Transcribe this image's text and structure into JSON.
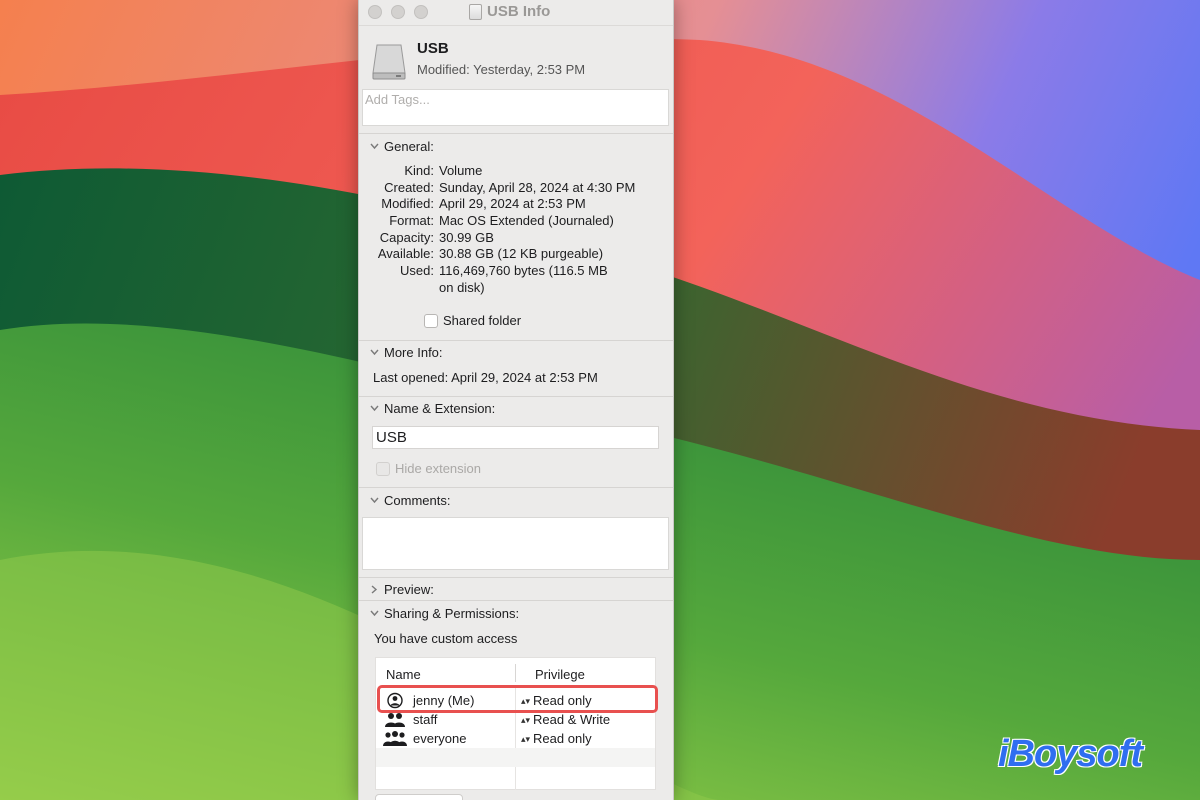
{
  "window": {
    "title": "USB Info"
  },
  "header": {
    "name": "USB",
    "modified": "Modified: Yesterday, 2:53 PM",
    "tags_placeholder": "Add Tags..."
  },
  "general": {
    "label": "General:",
    "rows": [
      {
        "key": "Kind:",
        "value": "Volume"
      },
      {
        "key": "Created:",
        "value": "Sunday, April 28, 2024 at 4:30 PM"
      },
      {
        "key": "Modified:",
        "value": "April 29, 2024 at 2:53 PM"
      },
      {
        "key": "Format:",
        "value": "Mac OS Extended (Journaled)"
      },
      {
        "key": "Capacity:",
        "value": "30.99 GB"
      },
      {
        "key": "Available:",
        "value": "30.88 GB (12 KB purgeable)"
      },
      {
        "key": "Used:",
        "value": "116,469,760 bytes (116.5 MB"
      },
      {
        "key": "",
        "value": "on disk)"
      }
    ],
    "shared_folder_label": "Shared folder"
  },
  "more_info": {
    "label": "More Info:",
    "last_opened": "Last opened: April 29, 2024 at 2:53 PM"
  },
  "name_extension": {
    "label": "Name & Extension:",
    "name_value": "USB",
    "hide_extension_label": "Hide extension"
  },
  "comments": {
    "label": "Comments:"
  },
  "preview": {
    "label": "Preview:"
  },
  "sharing": {
    "label": "Sharing & Permissions:",
    "access_text": "You have custom access",
    "columns": [
      "Name",
      "Privilege"
    ],
    "rows": [
      {
        "icon": "single-user-icon",
        "name": "jenny (Me)",
        "privilege": "Read only"
      },
      {
        "icon": "user-group-icon",
        "name": "staff",
        "privilege": "Read & Write"
      },
      {
        "icon": "everyone-icon",
        "name": "everyone",
        "privilege": "Read only"
      }
    ]
  },
  "watermark": {
    "text": "iBoysoft"
  },
  "colors": {
    "highlight": "#e8504f",
    "brand": "#2f6ef0",
    "window_bg": "#ecebea"
  }
}
